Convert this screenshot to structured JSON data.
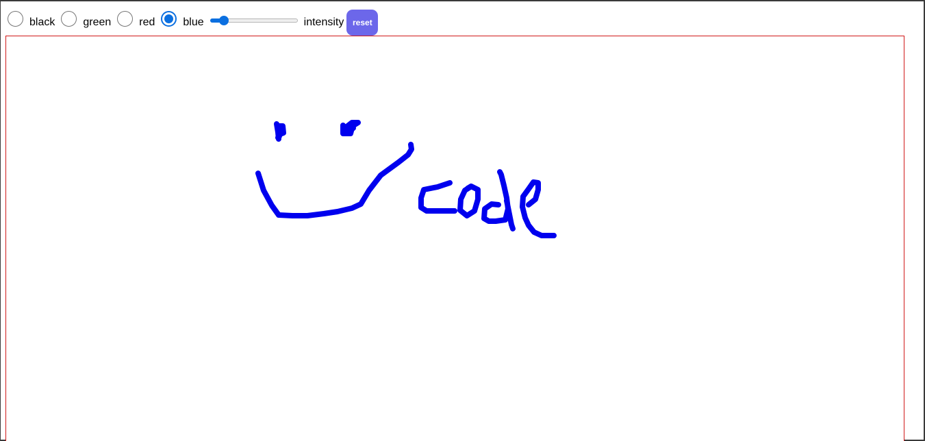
{
  "color_options": [
    {
      "label": "black",
      "checked": false
    },
    {
      "label": "green",
      "checked": false
    },
    {
      "label": "red",
      "checked": false
    },
    {
      "label": "blue",
      "checked": true
    }
  ],
  "intensity": {
    "label": "intensity",
    "value_fraction": 0.12
  },
  "reset_button": {
    "label": "reset"
  },
  "canvas": {
    "stroke_color": "#0000ee",
    "border_color": "#d01818"
  },
  "colors": {
    "accent": "#0b6fe0",
    "button": "#6c67ea"
  }
}
